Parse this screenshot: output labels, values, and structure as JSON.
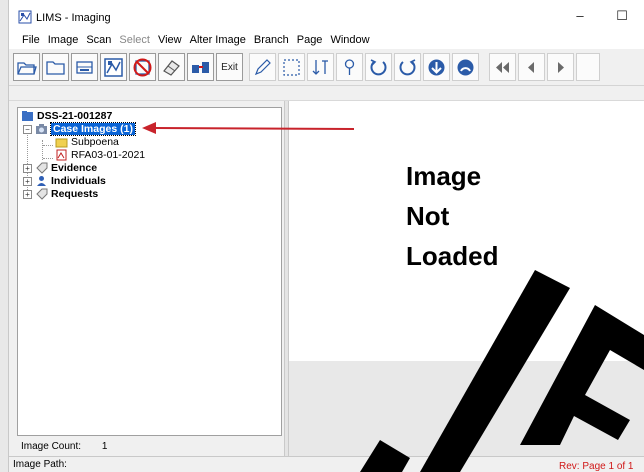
{
  "window": {
    "title": "LIMS - Imaging",
    "minimize": "–",
    "maximize": "☐"
  },
  "menu": [
    {
      "label": "File",
      "enabled": true
    },
    {
      "label": "Image",
      "enabled": true
    },
    {
      "label": "Scan",
      "enabled": true
    },
    {
      "label": "Select",
      "enabled": false
    },
    {
      "label": "View",
      "enabled": true
    },
    {
      "label": "Alter Image",
      "enabled": true
    },
    {
      "label": "Branch",
      "enabled": true
    },
    {
      "label": "Page",
      "enabled": true
    },
    {
      "label": "Window",
      "enabled": true
    }
  ],
  "toolbar": {
    "exit_label": "Exit"
  },
  "tree": {
    "root": "DSS-21-001287",
    "case_images": "Case Images (1)",
    "subpoena": "Subpoena",
    "rfa": "RFA03-01-2021",
    "evidence": "Evidence",
    "individuals": "Individuals",
    "requests": "Requests"
  },
  "image_count": {
    "label": "Image Count:",
    "value": "1"
  },
  "viewer": {
    "line1": "Image",
    "line2": "Not",
    "line3": "Loaded"
  },
  "status": {
    "image_path_label": "Image Path:",
    "rev": "Rev: Page 1 of 1"
  },
  "colors": {
    "accent": "#0a64d6",
    "annotation_arrow": "#c8232b",
    "rev_text": "#d01818"
  }
}
